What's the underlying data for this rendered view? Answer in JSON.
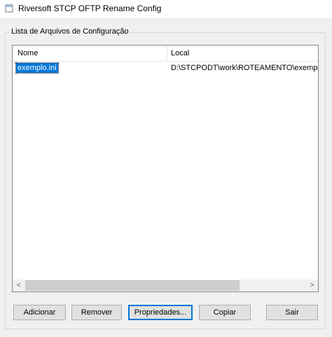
{
  "window": {
    "title": "Riversoft STCP OFTP Rename Config"
  },
  "group": {
    "label": "Lista de Arquivos de Configuração"
  },
  "list": {
    "columns": [
      "Nome",
      "Local"
    ],
    "rows": [
      {
        "name": "exemplo.ini",
        "local": "D:\\STCPODT\\work\\ROTEAMENTO\\exemplo.ini"
      }
    ]
  },
  "scrollbar": {
    "left_arrow": "<",
    "right_arrow": ">"
  },
  "buttons": {
    "add": "Adicionar",
    "remove": "Remover",
    "properties": "Propriedades...",
    "copy": "Copiar",
    "exit": "Sair"
  }
}
